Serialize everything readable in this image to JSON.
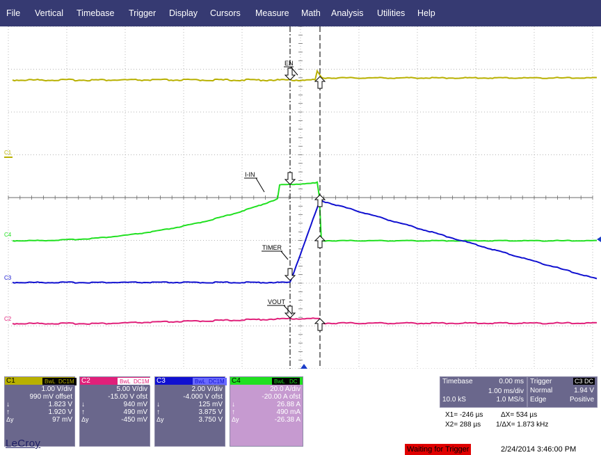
{
  "menu": [
    "File",
    "Vertical",
    "Timebase",
    "Trigger",
    "Display",
    "Cursors",
    "Measure",
    "Math",
    "Analysis",
    "Utilities",
    "Help"
  ],
  "colors": {
    "menubar": "#363a72",
    "c1": "#b8b000",
    "c2": "#e0207a",
    "c3": "#1010d0",
    "c4": "#20e020",
    "grid": "#9a9a9a",
    "cursor": "#202020"
  },
  "screen": {
    "channel_markers": [
      "C1",
      "C4",
      "C3",
      "C2"
    ],
    "annotations": [
      "EN",
      "I-IN",
      "TIMER",
      "VOUT"
    ]
  },
  "traces": [
    {
      "name": "C1",
      "tags": [
        "BwL",
        "DC1M"
      ],
      "vdiv": "1.00 V/div",
      "offset": "990 mV offset",
      "rows": [
        [
          "↓",
          "1.823 V"
        ],
        [
          "↑",
          "1.920 V"
        ],
        [
          "Δy",
          "97 mV"
        ]
      ]
    },
    {
      "name": "C2",
      "tags": [
        "BwL",
        "DC1M"
      ],
      "vdiv": "5.00 V/div",
      "offset": "-15.00 V ofst",
      "rows": [
        [
          "↓",
          "940 mV"
        ],
        [
          "↑",
          "490 mV"
        ],
        [
          "Δy",
          "-450 mV"
        ]
      ]
    },
    {
      "name": "C3",
      "tags": [
        "BwL",
        "DC1M"
      ],
      "vdiv": "2.00 V/div",
      "offset": "-4.000 V ofst",
      "rows": [
        [
          "↓",
          "125 mV"
        ],
        [
          "↑",
          "3.875 V"
        ],
        [
          "Δy",
          "3.750 V"
        ]
      ]
    },
    {
      "name": "C4",
      "tags": [
        "BwL",
        "DC"
      ],
      "vdiv": "20.0 A/div",
      "offset": "-20.00 A ofst",
      "rows": [
        [
          "↓",
          "26.88 A"
        ],
        [
          "↑",
          "490 mA"
        ],
        [
          "Δy",
          "-26.38 A"
        ]
      ]
    }
  ],
  "timebase": {
    "label": "Timebase",
    "delay": "0.00 ms",
    "div": "1.00 ms/div",
    "samples": "10.0 kS",
    "rate": "1.0 MS/s"
  },
  "trigger": {
    "label": "Trigger",
    "tag": "C3 DC",
    "mode": "Normal",
    "level": "1.94 V",
    "type": "Edge",
    "slope": "Positive"
  },
  "cursors": {
    "x1": "X1=  -246 µs",
    "dx": "ΔX=      534 µs",
    "x2": "X2=   288 µs",
    "inv": "1/ΔX=   1.873 kHz"
  },
  "logo": "LeCroy",
  "status": {
    "waiting": "Waiting for Trigger",
    "timestamp": "2/24/2014 3:46:00 PM"
  }
}
